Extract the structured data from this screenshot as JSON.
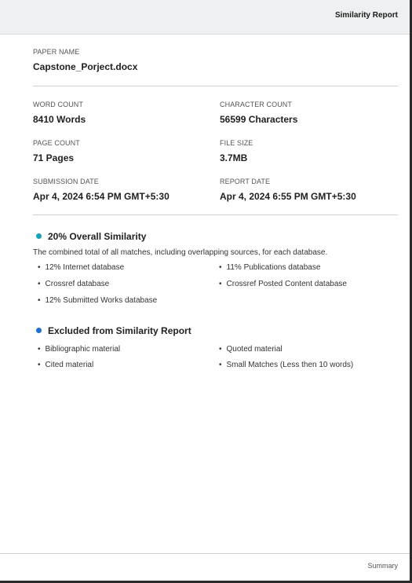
{
  "header": {
    "title": "Similarity Report"
  },
  "paper": {
    "label": "PAPER NAME",
    "value": "Capstone_Porject.docx"
  },
  "stats": {
    "word_count": {
      "label": "WORD COUNT",
      "value": "8410 Words"
    },
    "character_count": {
      "label": "CHARACTER COUNT",
      "value": "56599 Characters"
    },
    "page_count": {
      "label": "PAGE COUNT",
      "value": "71 Pages"
    },
    "file_size": {
      "label": "FILE SIZE",
      "value": "3.7MB"
    },
    "submission_date": {
      "label": "SUBMISSION DATE",
      "value": "Apr 4, 2024 6:54 PM GMT+5:30"
    },
    "report_date": {
      "label": "REPORT DATE",
      "value": "Apr 4, 2024 6:55 PM GMT+5:30"
    }
  },
  "similarity": {
    "title": "20% Overall Similarity",
    "dot_color": "#14a3b8",
    "description": "The combined total of all matches, including overlapping sources, for each database.",
    "items_left": [
      "12% Internet database",
      "Crossref database",
      "12% Submitted Works database"
    ],
    "items_right": [
      "11% Publications database",
      "Crossref Posted Content database"
    ]
  },
  "excluded": {
    "title": "Excluded from Similarity Report",
    "dot_color": "#1f6fd1",
    "items_left": [
      "Bibliographic material",
      "Cited material"
    ],
    "items_right": [
      "Quoted material",
      "Small Matches (Less then 10 words)"
    ]
  },
  "footer": {
    "label": "Summary"
  }
}
